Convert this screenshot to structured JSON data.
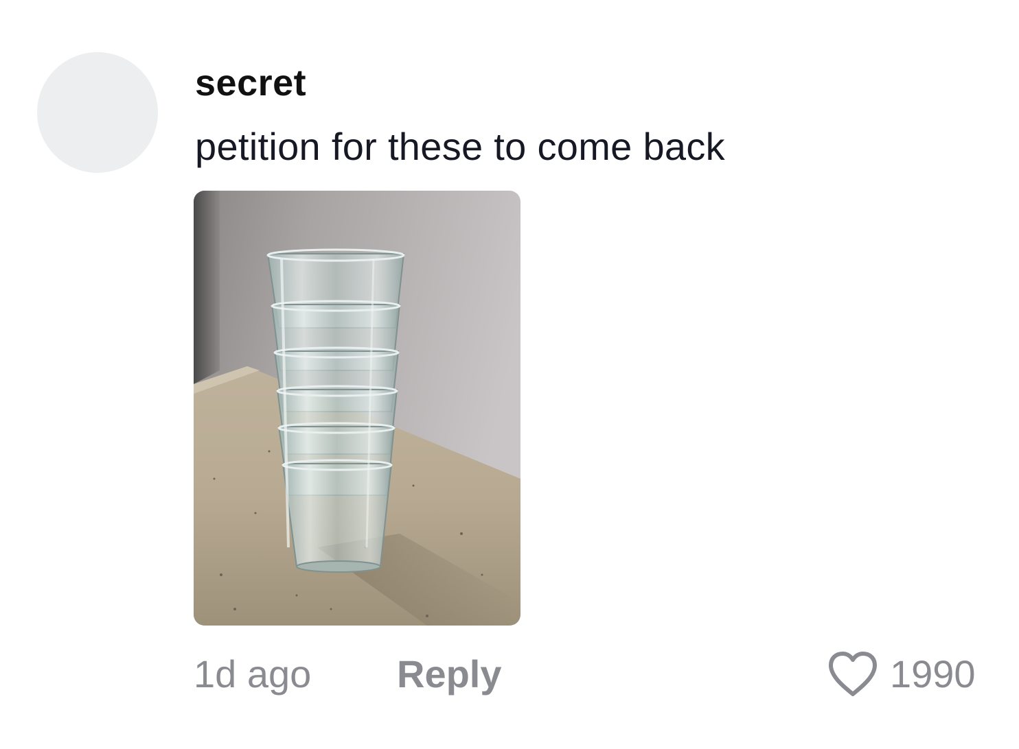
{
  "comment": {
    "username": "secret",
    "text": "petition for these to come back",
    "timestamp": "1d ago",
    "reply_label": "Reply",
    "like_count": "1990",
    "avatar": "avatar-placeholder",
    "attachment": "photo-stacked-glass-cups",
    "icons": {
      "like": "heart-outline-icon"
    },
    "colors": {
      "username": "#111111",
      "text": "#161823",
      "secondary": "#8a8b91",
      "avatar_bg": "#eceeef"
    }
  }
}
